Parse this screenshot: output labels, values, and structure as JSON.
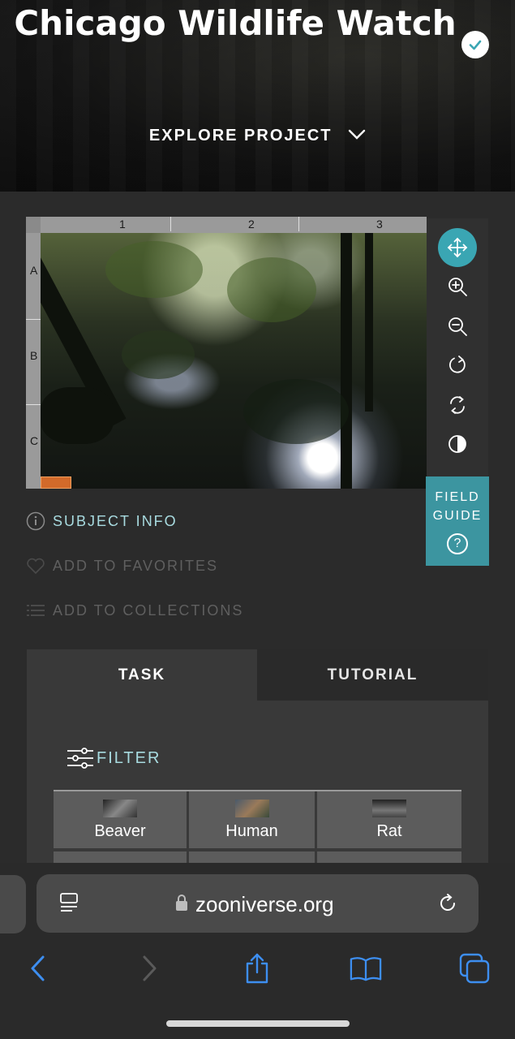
{
  "header": {
    "title": "Chicago Wildlife Watch",
    "explore_label": "EXPLORE PROJECT",
    "icons": {
      "verified": "check-circle-icon",
      "explore": "chevron-down-icon"
    }
  },
  "viewer": {
    "ruler_columns": [
      "1",
      "2",
      "3"
    ],
    "ruler_rows": [
      "A",
      "B",
      "C"
    ],
    "tools": [
      "move-icon",
      "zoom-in-icon",
      "zoom-out-icon",
      "rotate-icon",
      "reset-icon",
      "invert-icon"
    ],
    "field_guide": {
      "line1": "FIELD",
      "line2": "GUIDE",
      "help": "?"
    }
  },
  "meta": {
    "subject_info": "SUBJECT INFO",
    "favorites": "ADD TO FAVORITES",
    "collections": "ADD TO COLLECTIONS"
  },
  "panel": {
    "tabs": [
      {
        "label": "TASK",
        "active": true
      },
      {
        "label": "TUTORIAL",
        "active": false
      }
    ],
    "filter_label": "FILTER",
    "choices": [
      "Beaver",
      "Human",
      "Rat"
    ]
  },
  "browser": {
    "url": "zooniverse.org"
  },
  "colors": {
    "accent": "#3aa6b3",
    "link": "#a8dbe0",
    "safari_blue": "#3d8ef0"
  }
}
